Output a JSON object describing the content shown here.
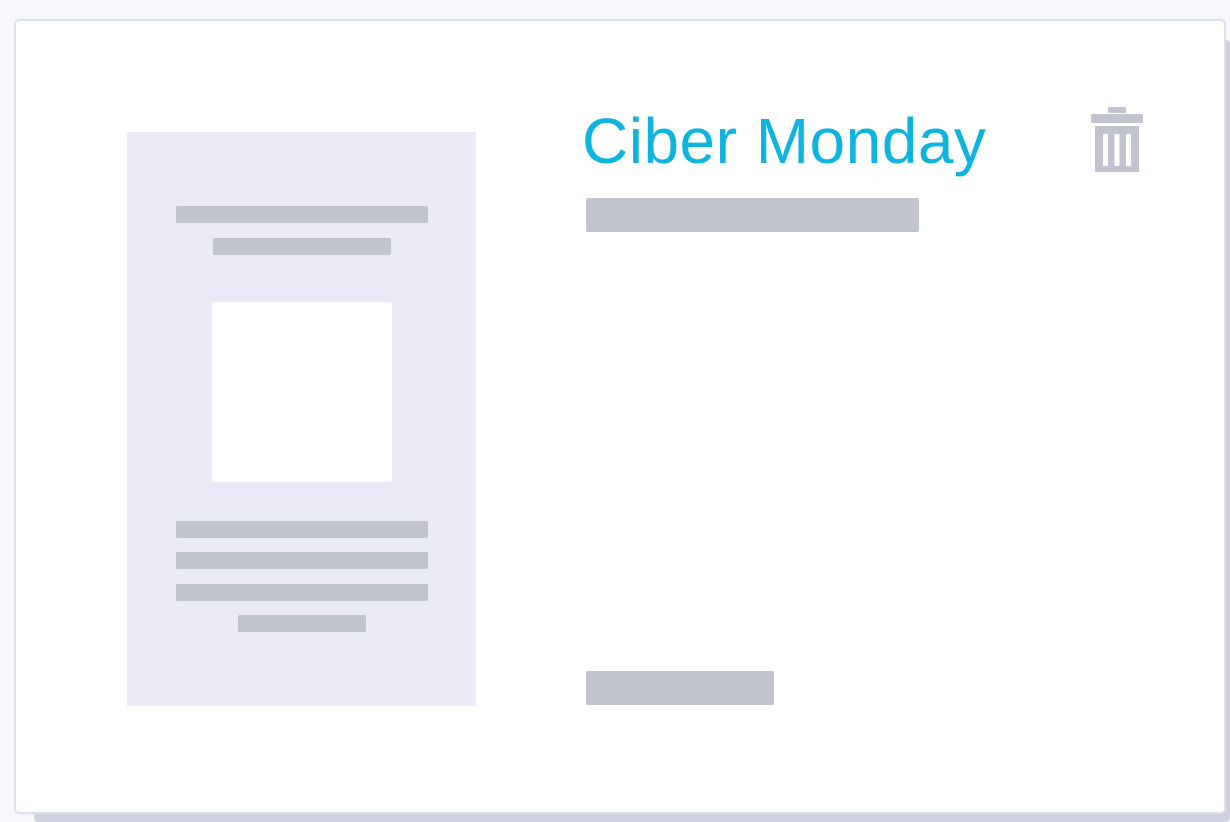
{
  "card": {
    "title": "Ciber Monday",
    "title_color": "#0fb4de",
    "delete_icon": "trash-icon"
  },
  "colors": {
    "placeholder_bar": "#c1c3cf",
    "preview_bg": "#eaebf6",
    "icon": "#c1c3cf"
  }
}
